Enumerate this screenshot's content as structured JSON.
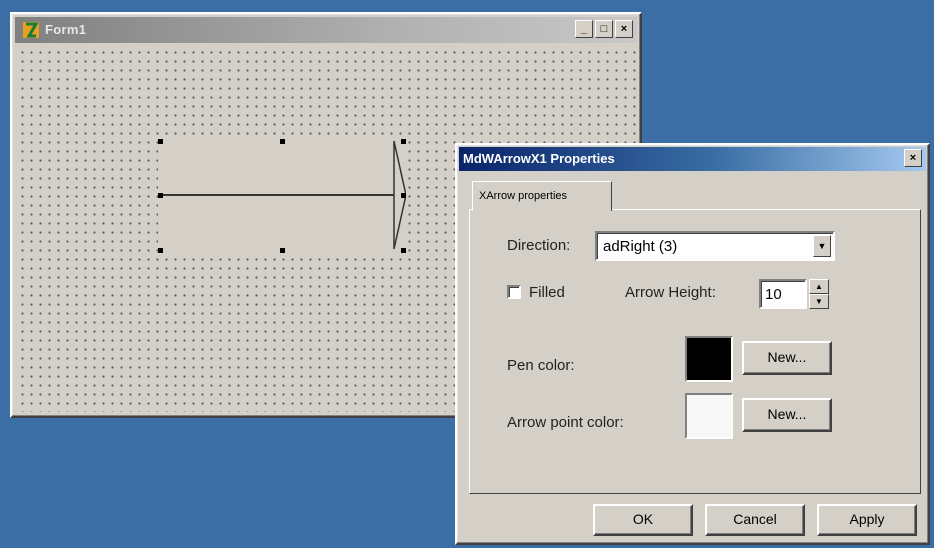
{
  "form_window": {
    "title": "Form1"
  },
  "dialog": {
    "title": "MdWArrowX1 Properties",
    "tab_label": "XArrow properties",
    "direction_label": "Direction:",
    "direction_value": "adRight (3)",
    "filled_label": "Filled",
    "filled_checked": false,
    "arrow_height_label": "Arrow Height:",
    "arrow_height_value": "10",
    "pen_color_label": "Pen color:",
    "pen_color": "#000000",
    "arrow_point_color_label": "Arrow point color:",
    "arrow_point_color": "#f8f8f8",
    "new_button_label": "New...",
    "ok_label": "OK",
    "cancel_label": "Cancel",
    "apply_label": "Apply"
  },
  "colors": {
    "desktop": "#3a6ea5",
    "face": "#d4d0c8",
    "active_title": "#0a246a"
  }
}
